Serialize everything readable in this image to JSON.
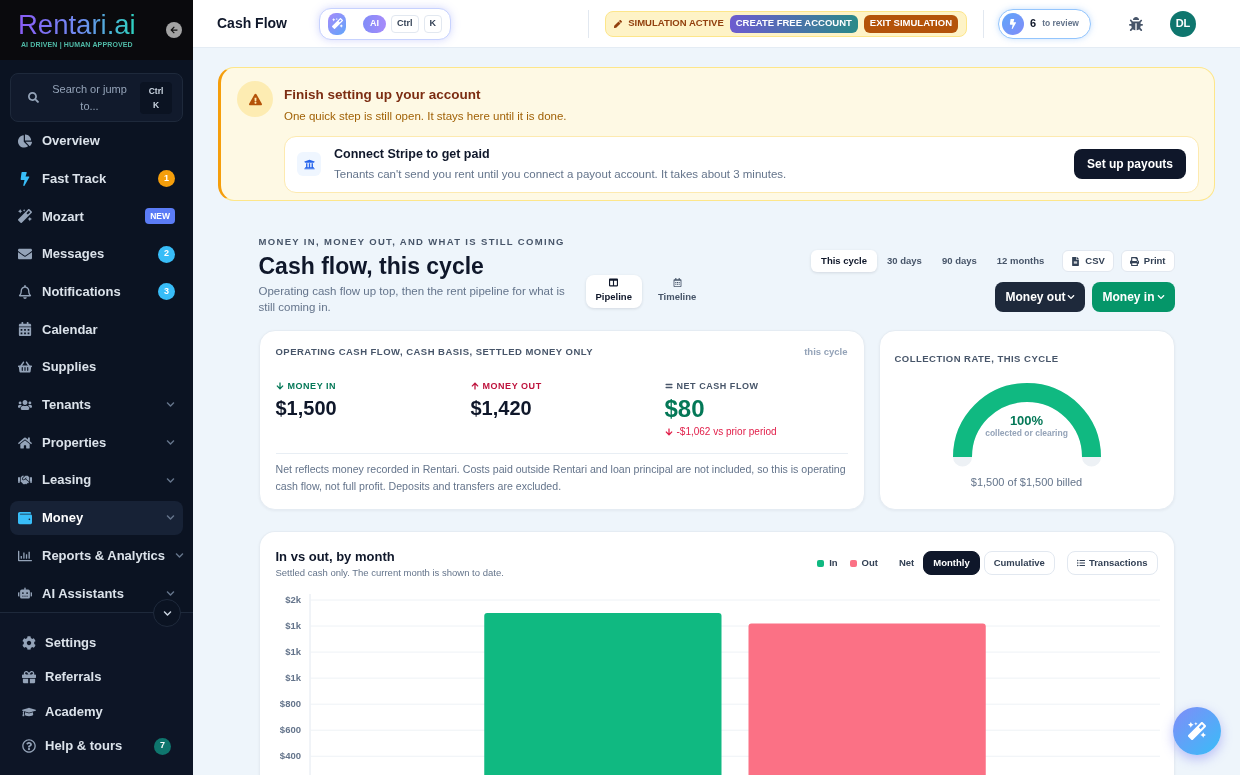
{
  "sidebar": {
    "logo": {
      "name": "Rentari.ai",
      "tagline": "AI DRIVEN | HUMAN APPROVED"
    },
    "search": {
      "label": "Search or jump to...",
      "shortcut": "Ctrl K"
    },
    "nav": [
      {
        "label": "Overview",
        "kind": "link",
        "selected": false
      },
      {
        "label": "Fast Track",
        "kind": "link",
        "selected": false,
        "badge": {
          "kind": "count",
          "text": "1",
          "color": "#f59e0b"
        }
      },
      {
        "label": "Mozart",
        "kind": "link",
        "selected": false,
        "badge": {
          "kind": "tag",
          "text": "NEW",
          "color": "#5b7cf6"
        }
      },
      {
        "label": "Messages",
        "kind": "link",
        "selected": false,
        "badge": {
          "kind": "count",
          "text": "2",
          "color": "#38bdf8"
        }
      },
      {
        "label": "Notifications",
        "kind": "link",
        "selected": false,
        "badge": {
          "kind": "count",
          "text": "3",
          "color": "#38bdf8"
        }
      },
      {
        "label": "Calendar",
        "kind": "link",
        "selected": false
      },
      {
        "label": "Supplies",
        "kind": "link",
        "selected": false
      },
      {
        "label": "Tenants",
        "kind": "group",
        "selected": false
      },
      {
        "label": "Properties",
        "kind": "group",
        "selected": false
      },
      {
        "label": "Leasing",
        "kind": "group",
        "selected": false
      },
      {
        "label": "Money",
        "kind": "group",
        "selected": true
      },
      {
        "label": "Reports & Analytics",
        "kind": "group",
        "selected": false
      },
      {
        "label": "AI Assistants",
        "kind": "group",
        "selected": false
      }
    ],
    "footer_nav": [
      {
        "label": "Settings",
        "selected": false
      },
      {
        "label": "Referrals",
        "selected": false
      },
      {
        "label": "Academy",
        "selected": false
      },
      {
        "label": "Help & tours",
        "selected": false,
        "badge": {
          "kind": "count",
          "text": "7",
          "color": "#0f766e"
        }
      }
    ]
  },
  "header": {
    "title": "Cash Flow",
    "ai_bar": {
      "label": "AI",
      "keys": [
        "Ctrl",
        "K"
      ]
    },
    "simulation": {
      "status": "SIMULATION ACTIVE",
      "actions": [
        {
          "label": "CREATE FREE ACCOUNT",
          "kind": "signup"
        },
        {
          "label": "EXIT SIMULATION",
          "kind": "exit"
        }
      ]
    },
    "review": {
      "count": "6",
      "label": "to review"
    },
    "avatar": {
      "initials": "DL"
    }
  },
  "setup_banner": {
    "title": "Finish setting up your account",
    "subtitle": "One quick step is still open. It stays here until it is done.",
    "steps": [
      {
        "title": "Connect Stripe to get paid",
        "description": "Tenants can't send you rent until you connect a payout account. It takes about 3 minutes.",
        "action": "Set up payouts"
      }
    ]
  },
  "cash_flow": {
    "eyebrow": "MONEY IN, MONEY OUT, AND WHAT IS STILL COMING",
    "title": "Cash flow, this cycle",
    "subtitle": "Operating cash flow up top, then the rent pipeline for what is still coming in.",
    "views": [
      {
        "label": "Pipeline",
        "selected": true
      },
      {
        "label": "Timeline",
        "selected": false
      }
    ],
    "ranges": [
      {
        "label": "This cycle",
        "selected": true
      },
      {
        "label": "30 days",
        "selected": false
      },
      {
        "label": "90 days",
        "selected": false
      },
      {
        "label": "12 months",
        "selected": false
      }
    ],
    "exports": [
      {
        "label": "CSV",
        "kind": "csv"
      },
      {
        "label": "Print",
        "kind": "print"
      }
    ],
    "actions": [
      {
        "label": "Money out",
        "kind": "out"
      },
      {
        "label": "Money in",
        "kind": "in"
      }
    ],
    "summary": {
      "title": "OPERATING CASH FLOW, CASH BASIS, SETTLED MONEY ONLY",
      "period": "this cycle",
      "metrics": [
        {
          "kind": "in",
          "label": "MONEY IN",
          "value": "$1,500"
        },
        {
          "kind": "out",
          "label": "MONEY OUT",
          "value": "$1,420"
        },
        {
          "kind": "net",
          "label": "NET CASH FLOW",
          "value": "$80",
          "change": "-$1,062 vs prior period"
        }
      ],
      "note": "Net reflects money recorded in Rentari. Costs paid outside Rentari and loan principal are not included, so this is operating cash flow, not full profit. Deposits and transfers are excluded."
    },
    "collection": {
      "title": "COLLECTION RATE, THIS CYCLE",
      "level": 1,
      "reading": "100%",
      "caption": "collected or clearing",
      "footer": "$1,500 of $1,500 billed"
    },
    "chart": {
      "title": "In vs out, by month",
      "subtitle": "Settled cash only. The current month is shown to date.",
      "net": {
        "label": "Net",
        "on": false
      },
      "modes": [
        {
          "label": "Monthly",
          "selected": true
        },
        {
          "label": "Cumulative",
          "selected": false
        }
      ],
      "action": "Transactions",
      "chart_data": {
        "type": "bar",
        "grid": true,
        "series": [
          {
            "name": "In",
            "color": "#10b981",
            "values": [
              1500
            ]
          },
          {
            "name": "Out",
            "color": "#fb7185",
            "values": [
              1420
            ]
          }
        ],
        "ylim": [
          210,
          1600
        ],
        "yticks": [
          {
            "value": 1600,
            "label": "$2k"
          },
          {
            "value": 1400,
            "label": "$1k"
          },
          {
            "value": 1200,
            "label": "$1k"
          },
          {
            "value": 1000,
            "label": "$1k"
          },
          {
            "value": 800,
            "label": "$800"
          },
          {
            "value": 600,
            "label": "$600"
          },
          {
            "value": 400,
            "label": "$400"
          }
        ]
      }
    }
  }
}
